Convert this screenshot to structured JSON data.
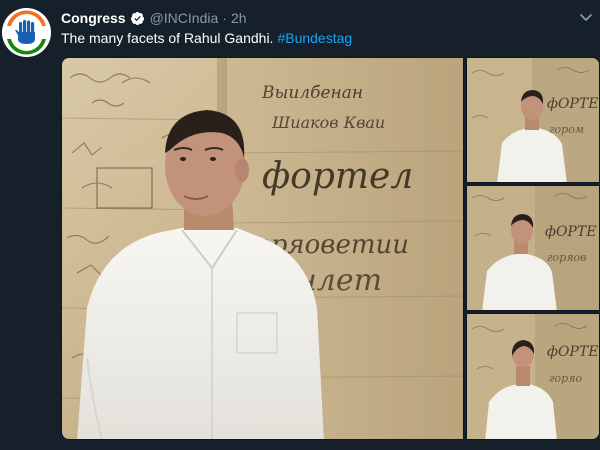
{
  "author": {
    "name": "Congress",
    "handle": "@INCIndia",
    "separator": "·",
    "time": "2h"
  },
  "tweet": {
    "text": "The many facets of Rahul Gandhi.",
    "hashtag": "#Bundestag"
  },
  "colors": {
    "background": "#15202b",
    "link": "#1da1f2",
    "muted": "#8899a6",
    "verified": "#1da1f2"
  },
  "icons": {
    "verified": "verified-badge-icon",
    "menu": "chevron-down-icon"
  },
  "media": {
    "photo_count": 4,
    "wall_graffiti": [
      "фортел",
      "горяоветии",
      "Шиаков Кваи"
    ]
  }
}
